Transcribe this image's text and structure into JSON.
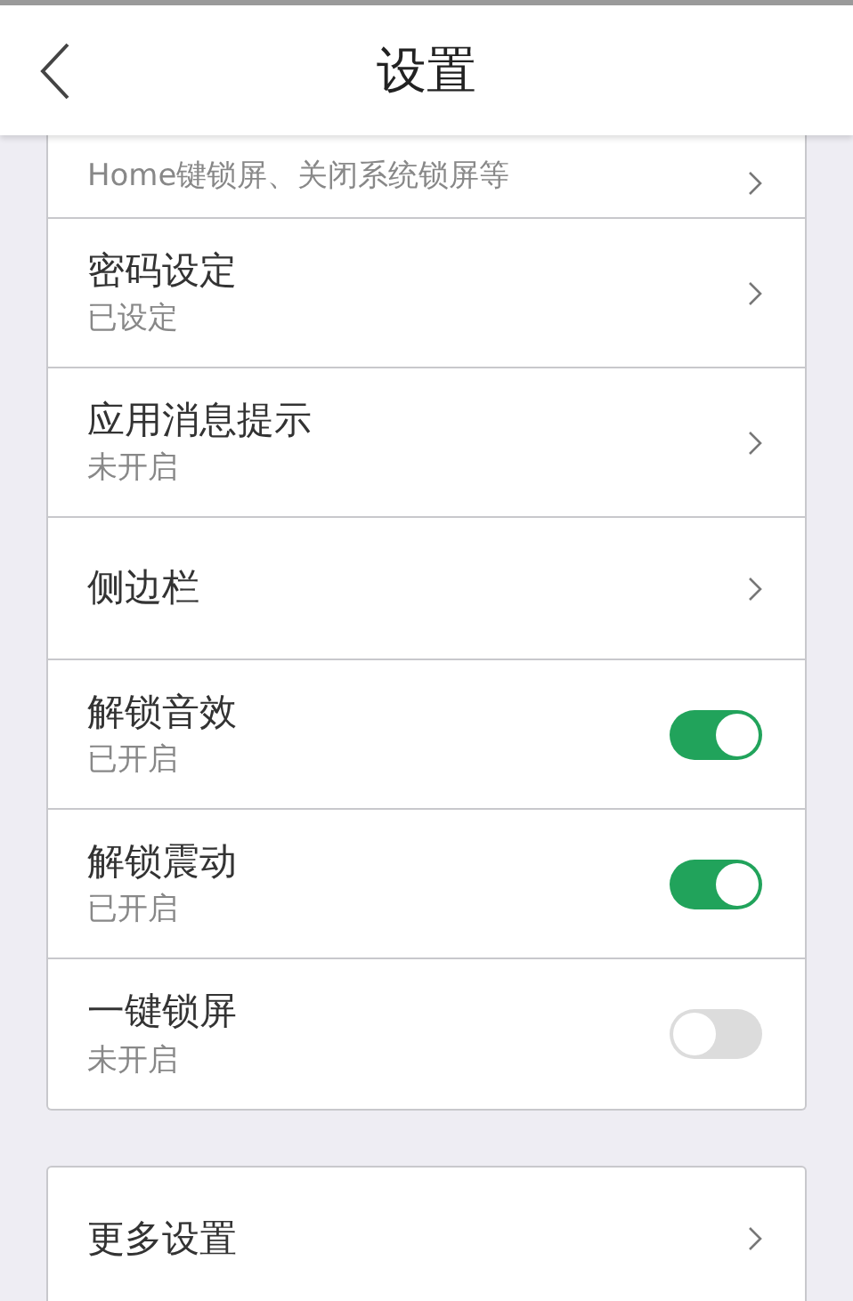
{
  "header": {
    "title": "设置"
  },
  "settings": [
    {
      "kind": "link",
      "subtitle": "Home键锁屏、关闭系统锁屏等"
    },
    {
      "kind": "link",
      "title": "密码设定",
      "subtitle": "已设定"
    },
    {
      "kind": "link",
      "title": "应用消息提示",
      "subtitle": "未开启"
    },
    {
      "kind": "link",
      "title": "侧边栏"
    },
    {
      "kind": "toggle",
      "title": "解锁音效",
      "subtitle": "已开启",
      "on": true
    },
    {
      "kind": "toggle",
      "title": "解锁震动",
      "subtitle": "已开启",
      "on": true
    },
    {
      "kind": "toggle",
      "title": "一键锁屏",
      "subtitle": "未开启",
      "on": false
    }
  ],
  "more": [
    {
      "kind": "link",
      "title": "更多设置"
    }
  ]
}
